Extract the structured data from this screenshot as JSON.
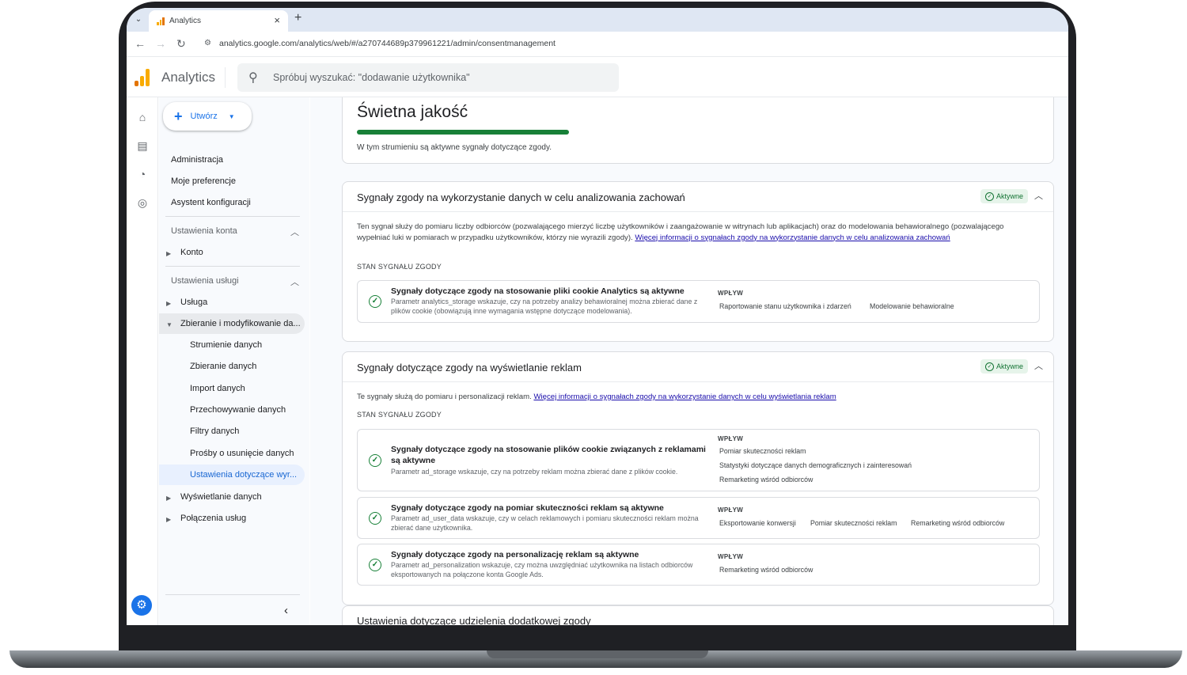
{
  "browser": {
    "tab_title": "Analytics",
    "tab_close": "×",
    "new_tab": "+",
    "url": "analytics.google.com/analytics/web/#/a270744689p379961221/admin/consentmanagement"
  },
  "header": {
    "app_name": "Analytics",
    "search_placeholder": "Spróbuj wyszukać: \"dodawanie użytkownika\""
  },
  "sidenav": {
    "create_label": "Utwórz",
    "top_items": [
      "Administracja",
      "Moje preferencje",
      "Asystent konfiguracji"
    ],
    "account_section": "Ustawienia konta",
    "account_items": [
      "Konto"
    ],
    "service_section": "Ustawienia usługi",
    "service_items": [
      "Usługa",
      "Zbieranie i modyfikowanie da..."
    ],
    "data_items": [
      "Strumienie danych",
      "Zbieranie danych",
      "Import danych",
      "Przechowywanie danych",
      "Filtry danych",
      "Prośby o usunięcie danych",
      "Ustawienia dotyczące wyr..."
    ],
    "bottom_items": [
      "Wyświetlanie danych",
      "Połączenia usług"
    ]
  },
  "quality": {
    "title": "Świetna jakość",
    "description": "W tym strumieniu są aktywne sygnały dotyczące zgody."
  },
  "section1": {
    "title": "Sygnały zgody na wykorzystanie danych w celu analizowania zachowań",
    "badge": "Aktywne",
    "text": "Ten sygnał służy do pomiaru liczby odbiorców (pozwalającego mierzyć liczbę użytkowników i zaangażowanie w witrynach lub aplikacjach) oraz do modelowania behawioralnego (pozwalającego wypełniać luki w pomiarach w przypadku użytkowników, którzy nie wyrazili zgody).",
    "link": "Więcej informacji o sygnałach zgody na wykorzystanie danych w celu analizowania zachowań",
    "status_label": "STAN SYGNAŁU ZGODY",
    "signals": [
      {
        "title": "Sygnały dotyczące zgody na stosowanie pliki cookie Analytics są aktywne",
        "desc": "Parametr analytics_storage wskazuje, czy na potrzeby analizy behawioralnej można zbierać dane z plików cookie (obowiązują inne wymagania wstępne dotyczące modelowania).",
        "impact_label": "WPŁYW",
        "impacts": [
          "Raportowanie stanu użytkownika i zdarzeń",
          "Modelowanie behawioralne"
        ]
      }
    ]
  },
  "section2": {
    "title": "Sygnały dotyczące zgody na wyświetlanie reklam",
    "badge": "Aktywne",
    "text": "Te sygnały służą do pomiaru i personalizacji reklam.",
    "link": "Więcej informacji o sygnałach zgody na wykorzystanie danych w celu wyświetlania reklam",
    "status_label": "STAN SYGNAŁU ZGODY",
    "signals": [
      {
        "title": "Sygnały dotyczące zgody na stosowanie plików cookie związanych z reklamami są aktywne",
        "desc": "Parametr ad_storage wskazuje, czy na potrzeby reklam można zbierać dane z plików cookie.",
        "impact_label": "WPŁYW",
        "impacts": [
          "Pomiar skuteczności reklam",
          "Statystyki dotyczące danych demograficznych i zainteresowań",
          "Remarketing wśród odbiorców"
        ]
      },
      {
        "title": "Sygnały dotyczące zgody na pomiar skuteczności reklam są aktywne",
        "desc": "Parametr ad_user_data wskazuje, czy w celach reklamowych i pomiaru skuteczności reklam można zbierać dane użytkownika.",
        "impact_label": "WPŁYW",
        "impacts": [
          "Eksportowanie konwersji",
          "Pomiar skuteczności reklam",
          "Remarketing wśród odbiorców"
        ]
      },
      {
        "title": "Sygnały dotyczące zgody na personalizację reklam są aktywne",
        "desc": "Parametr ad_personalization wskazuje, czy można uwzględniać użytkownika na listach odbiorców eksportowanych na połączone konta Google Ads.",
        "impact_label": "WPŁYW",
        "impacts": [
          "Remarketing wśród odbiorców"
        ]
      }
    ]
  },
  "section3": {
    "title": "Ustawienia dotyczące udzielenia dodatkowej zgody"
  },
  "colors": {
    "accent": "#1a73e8",
    "success": "#188038",
    "logo": [
      "#f9ab00",
      "#e37400",
      "#e37400"
    ]
  }
}
